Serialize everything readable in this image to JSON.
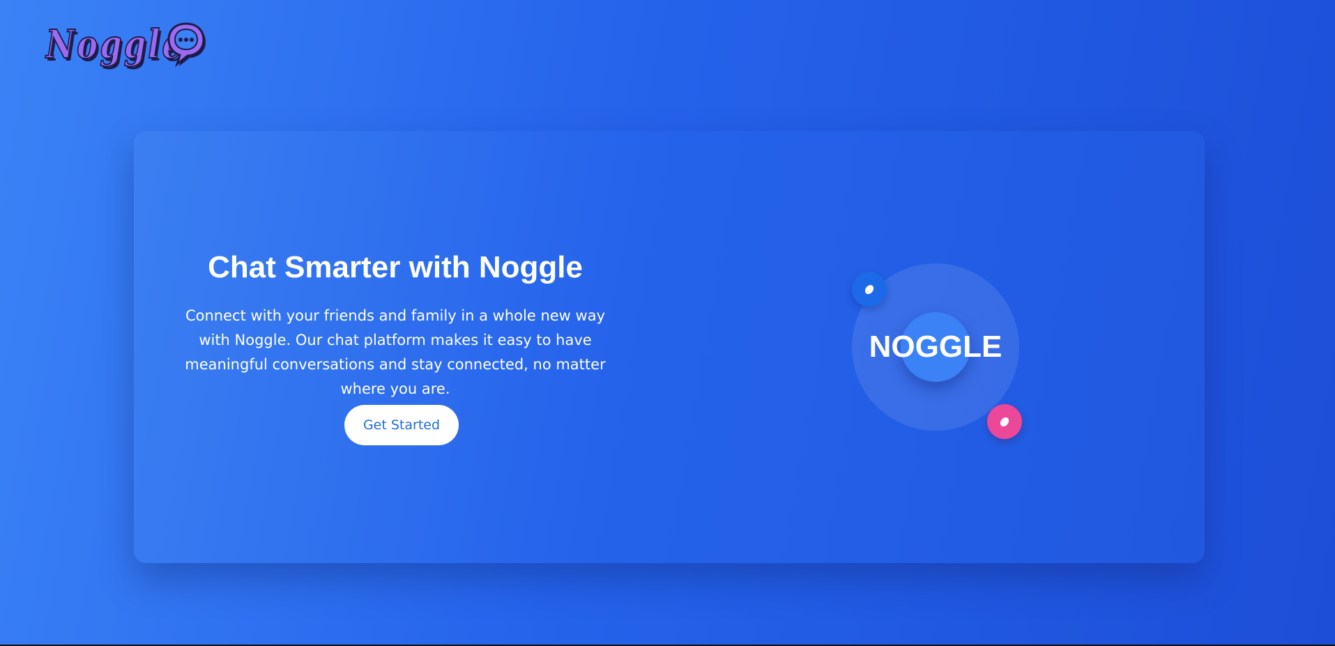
{
  "header": {
    "logo_text": "Noggle",
    "logo_icon": "chat-bubble-icon"
  },
  "hero": {
    "headline": "Chat Smarter with Noggle",
    "description": "Connect with your friends and family in a whole new way with Noggle. Our chat platform makes it easy to have meaningful conversations and stay connected, no matter where you are.",
    "cta_label": "Get Started"
  },
  "emblem": {
    "brand_word": "NOGGLE",
    "accent_icon_left": "chat-bubble-icon",
    "accent_icon_right": "chat-bubble-icon"
  },
  "colors": {
    "background_start": "#3b82f6",
    "background_end": "#1d4ed8",
    "logo_purple": "#9b6cf0",
    "button_text": "#1f6bdc",
    "accent_pink": "#ec4899",
    "accent_blue": "#1d6ae8"
  }
}
